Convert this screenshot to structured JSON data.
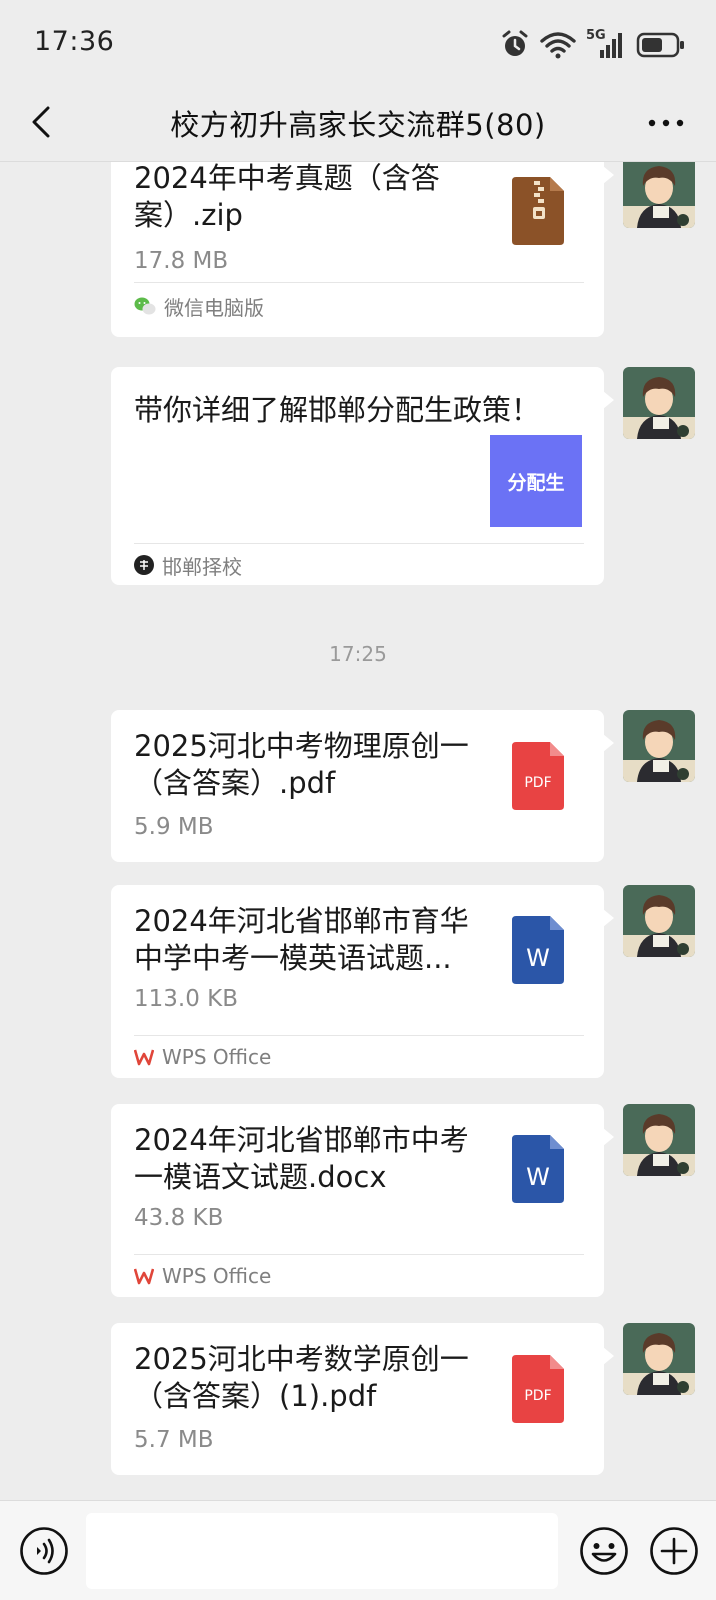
{
  "status_bar": {
    "time": "17:36",
    "network": "5G"
  },
  "header": {
    "title": "校方初升高家长交流群5(80)"
  },
  "messages": [
    {
      "name": "2024年中考真题（含答案）.zip",
      "size": "17.8 MB",
      "icon": "zip-file-icon",
      "source": "微信电脑版"
    },
    {
      "title": "带你详细了解邯郸分配生政策！",
      "thumb": "分配生",
      "source": "邯郸择校"
    },
    {
      "name": "2025河北中考物理原创一（含答案）.pdf",
      "size": "5.9 MB",
      "icon": "pdf-file-icon",
      "icon_label": "PDF"
    },
    {
      "name": "2024年河北省邯郸市育华中学中考一模英语试题...",
      "size": "113.0 KB",
      "icon": "word-file-icon",
      "icon_label": "W",
      "source": "WPS Office"
    },
    {
      "name": "2024年河北省邯郸市中考一模语文试题.docx",
      "size": "43.8 KB",
      "icon": "word-file-icon",
      "icon_label": "W",
      "source": "WPS Office"
    },
    {
      "name": "2025河北中考数学原创一（含答案）(1).pdf",
      "size": "5.7 MB",
      "icon": "pdf-file-icon",
      "icon_label": "PDF"
    }
  ],
  "time_divider": "17:25",
  "colors": {
    "pdf": "#e84343",
    "word": "#2b56a8",
    "zip": "#8b5228",
    "article_thumb": "#6b72f5",
    "wps": "#e0463a"
  }
}
